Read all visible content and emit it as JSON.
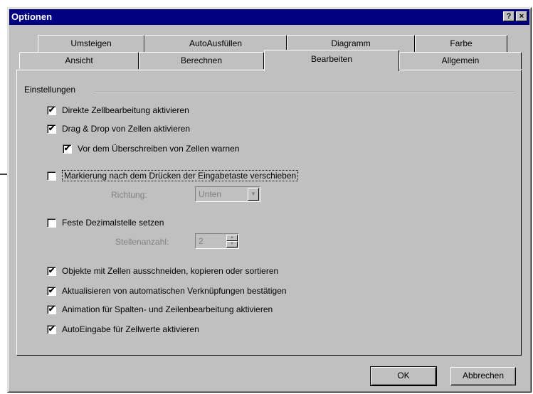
{
  "window": {
    "title": "Optionen",
    "help_glyph": "?",
    "close_glyph": "×"
  },
  "tabs": {
    "row1": [
      "Umsteigen",
      "AutoAusfüllen",
      "Diagramm",
      "Farbe"
    ],
    "row2": [
      "Ansicht",
      "Berechnen",
      "Bearbeiten",
      "Allgemein"
    ],
    "active": "Bearbeiten"
  },
  "group": {
    "title": "Einstellungen"
  },
  "options": {
    "direct_edit": {
      "label": "Direkte Zellbearbeitung aktivieren",
      "checked": true
    },
    "drag_drop": {
      "label": "Drag & Drop von Zellen aktivieren",
      "checked": true
    },
    "overwrite_warn": {
      "label": "Vor dem Überschreiben von Zellen warnen",
      "checked": true
    },
    "move_after_enter": {
      "label": "Markierung nach dem Drücken der Eingabetaste verschieben",
      "checked": false
    },
    "direction_label": "Richtung:",
    "direction_value": "Unten",
    "fixed_decimal": {
      "label": "Feste Dezimalstelle setzen",
      "checked": false
    },
    "places_label": "Stellenanzahl:",
    "places_value": "2",
    "cut_copy_sort": {
      "label": "Objekte mit Zellen ausschneiden, kopieren oder sortieren",
      "checked": true
    },
    "confirm_links": {
      "label": "Aktualisieren von automatischen Verknüpfungen bestätigen",
      "checked": true
    },
    "animation": {
      "label": "Animation für Spalten- und Zeilenbearbeitung aktivieren",
      "checked": true
    },
    "autocomplete": {
      "label": "AutoEingabe für Zellwerte aktivieren",
      "checked": true
    }
  },
  "buttons": {
    "ok": "OK",
    "cancel": "Abbrechen"
  },
  "icons": {
    "check": "✔",
    "dropdown": "chevron-down-icon",
    "spin_up": "▲",
    "spin_down": "▼",
    "combo_arrow": "▼"
  }
}
